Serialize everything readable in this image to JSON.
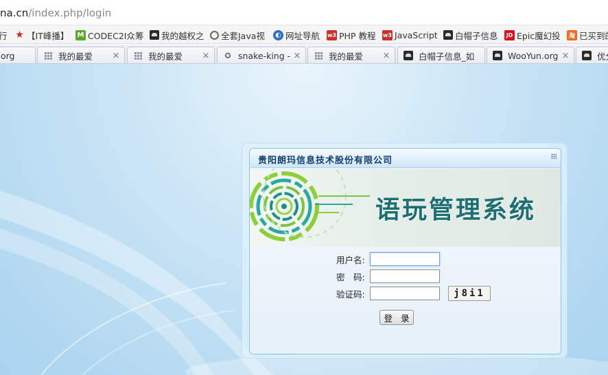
{
  "address_bar": {
    "host": "na.cn",
    "path": "/index.php/login"
  },
  "bookmarks": [
    {
      "label": "行",
      "icon": "none"
    },
    {
      "label": "【IT峰播】",
      "icon": "red-star-icon"
    },
    {
      "label": "CODEC2I众筹",
      "icon": "m-logo-icon"
    },
    {
      "label": "我的越权之",
      "icon": "hat-icon"
    },
    {
      "label": "全套Java视",
      "icon": "circle-icon"
    },
    {
      "label": "网址导航",
      "icon": "globe-icon"
    },
    {
      "label": "PHP 教程",
      "icon": "w3-icon"
    },
    {
      "label": "JavaScript",
      "icon": "w3-icon"
    },
    {
      "label": "白帽子信息",
      "icon": "hat-icon"
    },
    {
      "label": "Epic魔幻投",
      "icon": "jd-icon"
    },
    {
      "label": "已买到的",
      "icon": "taobao-icon"
    }
  ],
  "tabs": [
    {
      "label": ".org",
      "icon": "none"
    },
    {
      "label": "我的最爱",
      "icon": "grid-icon"
    },
    {
      "label": "我的最爱",
      "icon": "grid-icon"
    },
    {
      "label": "snake-king -",
      "icon": "gear-icon"
    },
    {
      "label": "我的最爱",
      "icon": "grid-icon"
    },
    {
      "label": "白帽子信息_如",
      "icon": "hat-icon"
    },
    {
      "label": "WooYun.org",
      "icon": "hat-icon"
    },
    {
      "label": "优分",
      "icon": "hat-icon"
    }
  ],
  "tab_close_glyph": "×",
  "login": {
    "company": "贵阳朗玛信息技术股份有限公司",
    "system_title": "语玩管理系统",
    "username_label": "用户名:",
    "password_label": "密　码:",
    "captcha_label": "验证码:",
    "username_value": "",
    "password_value": "",
    "captcha_value": "",
    "captcha_image_text": "j8i1",
    "login_button": "登 录"
  },
  "colors": {
    "company_text": "#123d73",
    "banner_title": "#1d6f73",
    "page_bg": "#c9e4f5"
  }
}
